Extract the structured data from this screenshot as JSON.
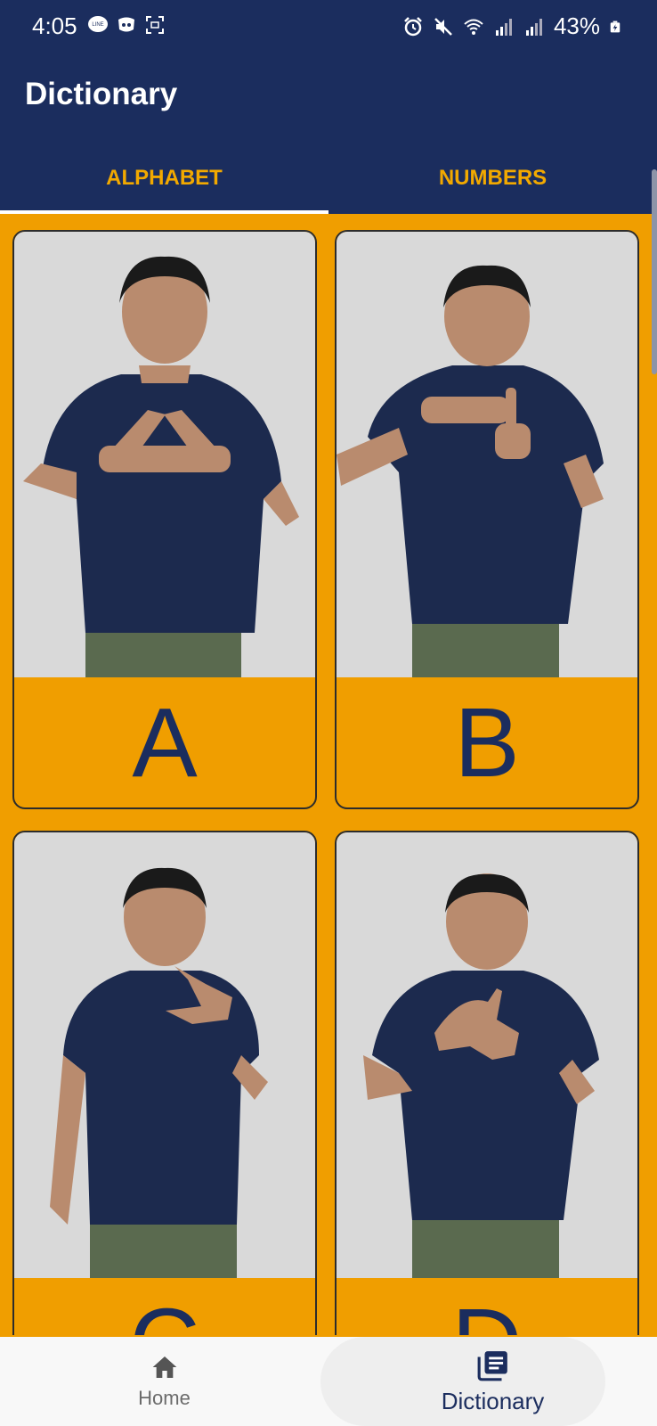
{
  "status_bar": {
    "time": "4:05",
    "battery": "43%",
    "icons_left": [
      "line-icon",
      "discord-icon",
      "screenshot-icon"
    ],
    "icons_right": [
      "alarm-icon",
      "mute-icon",
      "wifi-icon",
      "signal-icon",
      "signal-icon",
      "battery-icon"
    ]
  },
  "header": {
    "title": "Dictionary"
  },
  "tabs": [
    {
      "label": "ALPHABET",
      "active": true
    },
    {
      "label": "NUMBERS",
      "active": false
    }
  ],
  "cards": [
    {
      "letter": "A",
      "image": "person signing letter A"
    },
    {
      "letter": "B",
      "image": "person signing letter B"
    },
    {
      "letter": "C",
      "image": "person signing letter C"
    },
    {
      "letter": "D",
      "image": "person signing letter D"
    }
  ],
  "bottom_nav": [
    {
      "label": "Home",
      "icon": "home-icon",
      "active": false
    },
    {
      "label": "Dictionary",
      "icon": "book-list-icon",
      "active": true
    }
  ],
  "colors": {
    "primary": "#1b2d5e",
    "accent": "#f09e00",
    "tab_text": "#f2a900"
  }
}
